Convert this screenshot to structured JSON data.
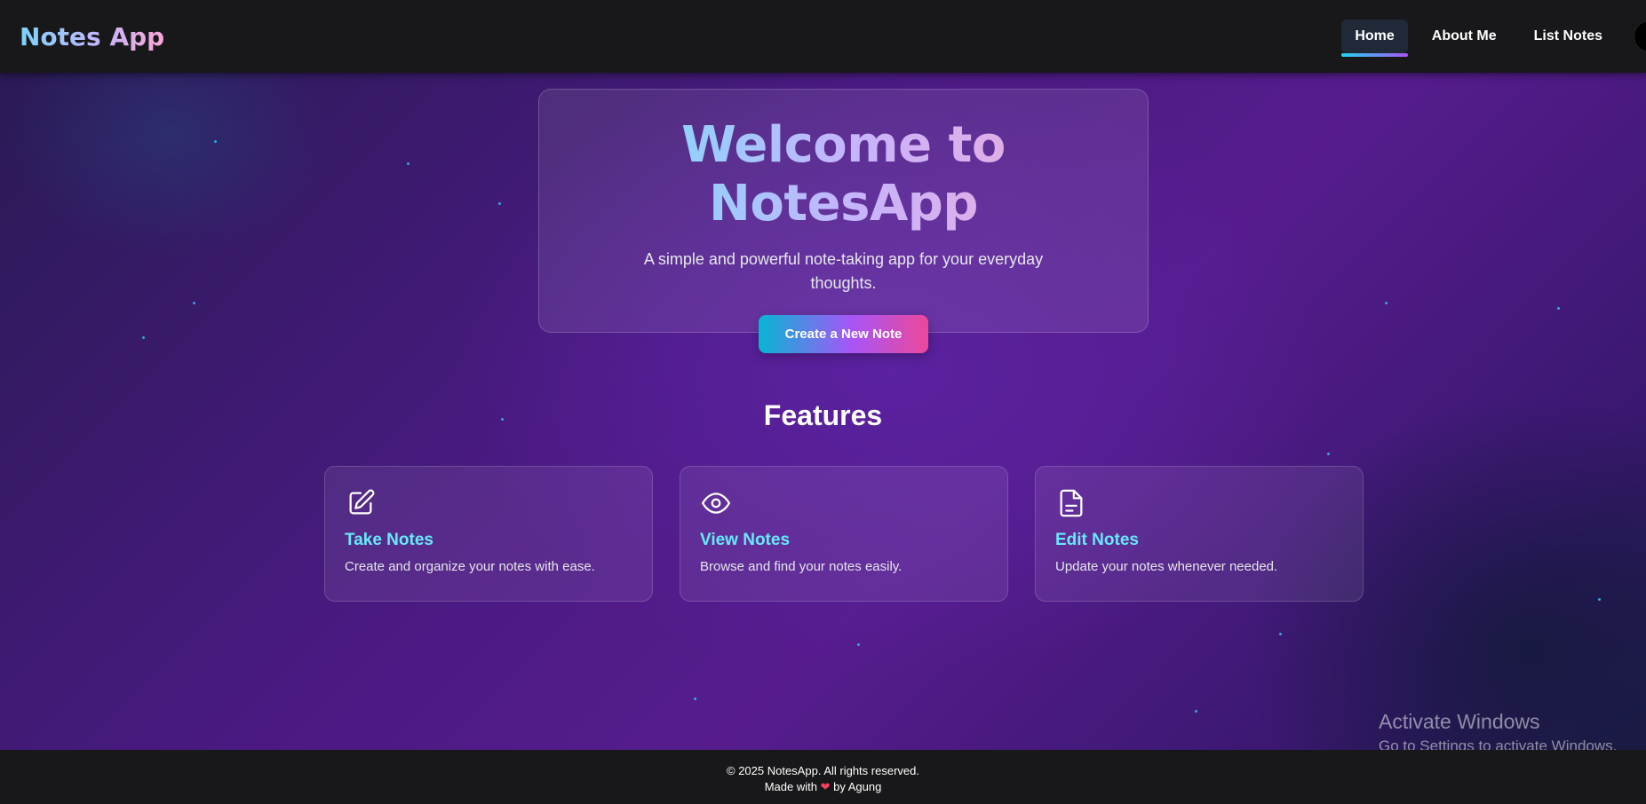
{
  "navbar": {
    "brand": "Notes App",
    "links": [
      {
        "label": "Home",
        "active": true
      },
      {
        "label": "About Me",
        "active": false
      },
      {
        "label": "List Notes",
        "active": false
      }
    ]
  },
  "hero": {
    "title": "Welcome to NotesApp",
    "subtitle": "A simple and powerful note-taking app for your everyday thoughts.",
    "cta_label": "Create a New Note"
  },
  "features": {
    "heading": "Features",
    "items": [
      {
        "icon": "pencil-square-icon",
        "title": "Take Notes",
        "description": "Create and organize your notes with ease."
      },
      {
        "icon": "eye-icon",
        "title": "View Notes",
        "description": "Browse and find your notes easily."
      },
      {
        "icon": "document-icon",
        "title": "Edit Notes",
        "description": "Update your notes whenever needed."
      }
    ]
  },
  "footer": {
    "copyright": "© 2025 NotesApp. All rights reserved.",
    "made_with_prefix": "Made with",
    "heart": "❤",
    "made_with_suffix": "by Agung"
  },
  "os_watermark": {
    "title": "Activate Windows",
    "subtitle": "Go to Settings to activate Windows."
  },
  "colors": {
    "accent_cyan": "#67e8f9",
    "accent_purple": "#a855f7",
    "accent_pink": "#ec4899",
    "navbar_bg": "#18181a"
  }
}
